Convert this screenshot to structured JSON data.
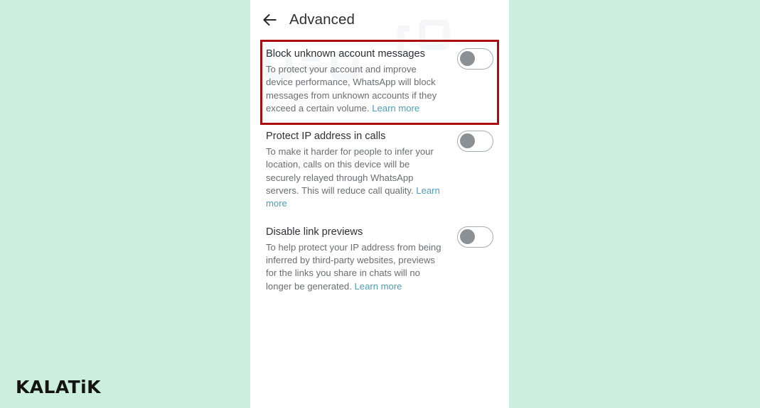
{
  "page": {
    "background_color": "#cbeede",
    "panel_background": "#ffffff"
  },
  "app_bar": {
    "back_icon": "arrow-left-icon",
    "title": "Advanced"
  },
  "highlight": {
    "color": "#a90d0d",
    "target": "block-unknown-account-messages"
  },
  "settings": [
    {
      "id": "block-unknown-account-messages",
      "title": "Block unknown account messages",
      "description": "To protect your account and improve device performance, WhatsApp will block messages from unknown accounts if they exceed a certain volume. ",
      "learn_more": "Learn more",
      "toggle_state": "off"
    },
    {
      "id": "protect-ip-address-in-calls",
      "title": "Protect IP address in calls",
      "description": "To make it harder for people to infer your location, calls on this device will be securely relayed through WhatsApp servers. This will reduce call quality. ",
      "learn_more": "Learn more",
      "toggle_state": "off"
    },
    {
      "id": "disable-link-previews",
      "title": "Disable link previews",
      "description": "To help protect your IP address from being inferred by third-party websites, previews for the links you share in chats will no longer be generated. ",
      "learn_more": "Learn more",
      "toggle_state": "off"
    }
  ],
  "brand": {
    "logo_text": "KALATiK"
  },
  "colors": {
    "link": "#4f9cb9",
    "title_text": "#2f3033",
    "body_text": "#6a6d70",
    "toggle_border": "#a8acaf",
    "toggle_knob": "#8b9094"
  }
}
